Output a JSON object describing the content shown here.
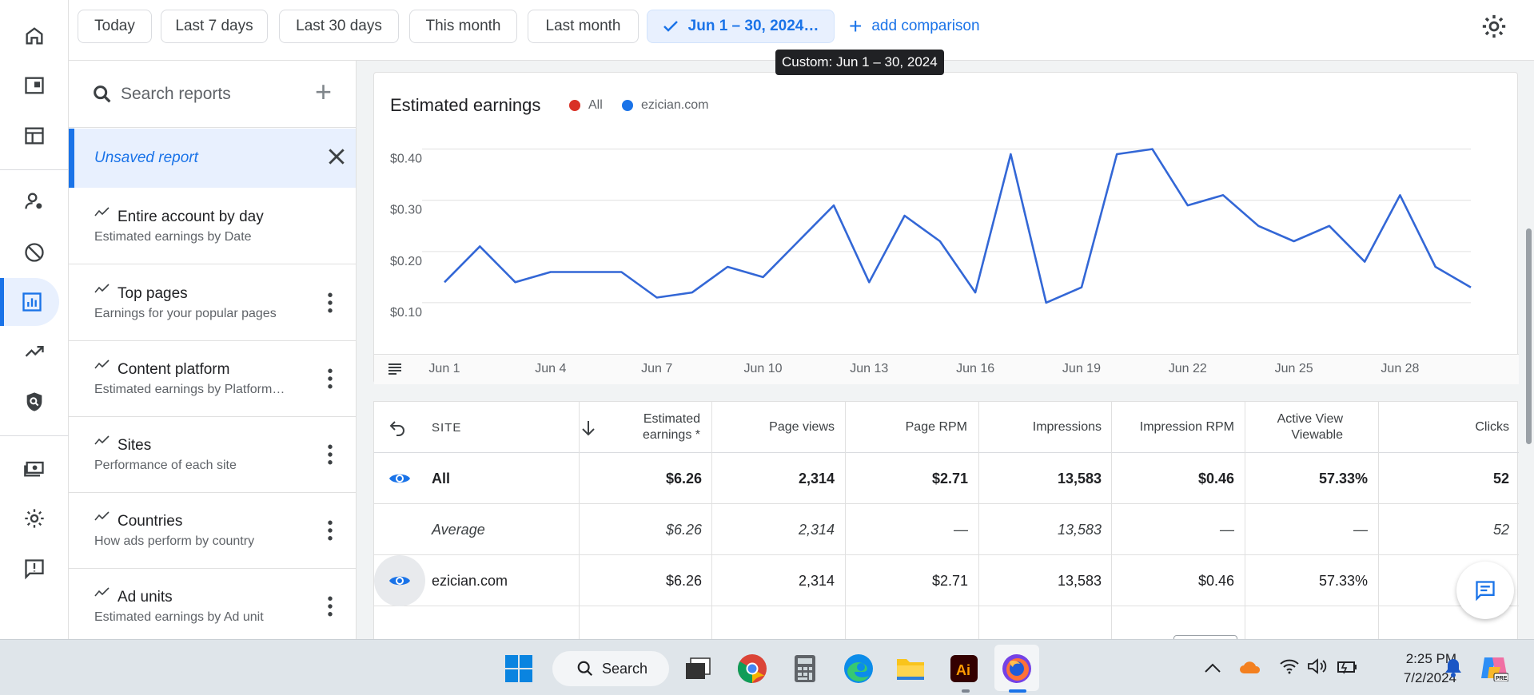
{
  "date_range": {
    "chips": [
      "Today",
      "Last 7 days",
      "Last 30 days",
      "This month",
      "Last month"
    ],
    "selected": "Jun 1 – 30, 2024…",
    "add_comparison": "add comparison",
    "tooltip": "Custom: Jun 1 – 30, 2024"
  },
  "reports": {
    "search_placeholder": "Search reports",
    "unsaved": "Unsaved report",
    "items": [
      {
        "title": "Entire account by day",
        "sub": "Estimated earnings by Date"
      },
      {
        "title": "Top pages",
        "sub": "Earnings for your popular pages"
      },
      {
        "title": "Content platform",
        "sub": "Estimated earnings by Platform…"
      },
      {
        "title": "Sites",
        "sub": "Performance of each site"
      },
      {
        "title": "Countries",
        "sub": "How ads perform by country"
      },
      {
        "title": "Ad units",
        "sub": "Estimated earnings by Ad unit"
      }
    ]
  },
  "chart": {
    "title": "Estimated earnings",
    "legend": [
      {
        "name": "All",
        "color": "#d93025"
      },
      {
        "name": "ezician.com",
        "color": "#1a73e8"
      }
    ]
  },
  "chart_data": {
    "type": "line",
    "title": "Estimated earnings",
    "x": [
      "Jun 1",
      "Jun 2",
      "Jun 3",
      "Jun 4",
      "Jun 5",
      "Jun 6",
      "Jun 7",
      "Jun 8",
      "Jun 9",
      "Jun 10",
      "Jun 11",
      "Jun 12",
      "Jun 13",
      "Jun 14",
      "Jun 15",
      "Jun 16",
      "Jun 17",
      "Jun 18",
      "Jun 19",
      "Jun 20",
      "Jun 21",
      "Jun 22",
      "Jun 23",
      "Jun 24",
      "Jun 25",
      "Jun 26",
      "Jun 27",
      "Jun 28",
      "Jun 29",
      "Jun 30"
    ],
    "x_tick_labels": [
      "Jun 1",
      "Jun 4",
      "Jun 7",
      "Jun 10",
      "Jun 13",
      "Jun 16",
      "Jun 19",
      "Jun 22",
      "Jun 25",
      "Jun 28"
    ],
    "series": [
      {
        "name": "ezician.com",
        "color": "#3367d6",
        "values": [
          0.14,
          0.21,
          0.14,
          0.16,
          0.16,
          0.16,
          0.11,
          0.12,
          0.17,
          0.15,
          0.22,
          0.29,
          0.14,
          0.27,
          0.22,
          0.12,
          0.39,
          0.1,
          0.13,
          0.39,
          0.4,
          0.29,
          0.31,
          0.25,
          0.22,
          0.25,
          0.18,
          0.31,
          0.17,
          0.13
        ]
      }
    ],
    "y_tick_labels": [
      "$0.40",
      "$0.30",
      "$0.20",
      "$0.10"
    ],
    "y_ticks": [
      0.4,
      0.3,
      0.2,
      0.1
    ],
    "ylim": [
      0.0,
      0.44
    ],
    "grid": true
  },
  "table": {
    "headers": {
      "site": "SITE",
      "earnings": "Estimated earnings *",
      "page_views": "Page views",
      "page_rpm": "Page RPM",
      "impressions": "Impressions",
      "impression_rpm": "Impression RPM",
      "active_view": "Active View Viewable",
      "clicks": "Clicks"
    },
    "rows": [
      {
        "site": "All",
        "earnings": "$6.26",
        "page_views": "2,314",
        "page_rpm": "$2.71",
        "impressions": "13,583",
        "impression_rpm": "$0.46",
        "active_view": "57.33%",
        "clicks": "52"
      },
      {
        "site": "Average",
        "earnings": "$6.26",
        "page_views": "2,314",
        "page_rpm": "—",
        "impressions": "13,583",
        "impression_rpm": "—",
        "active_view": "—",
        "clicks": "52"
      },
      {
        "site": "ezician.com",
        "earnings": "$6.26",
        "page_views": "2,314",
        "page_rpm": "$2.71",
        "impressions": "13,583",
        "impression_rpm": "$0.46",
        "active_view": "57.33%",
        "clicks": ""
      }
    ]
  },
  "taskbar": {
    "search": "Search",
    "time": "2:25 PM",
    "date": "7/2/2024"
  },
  "colors": {
    "accent": "#1a73e8",
    "line": "#3367d6"
  }
}
